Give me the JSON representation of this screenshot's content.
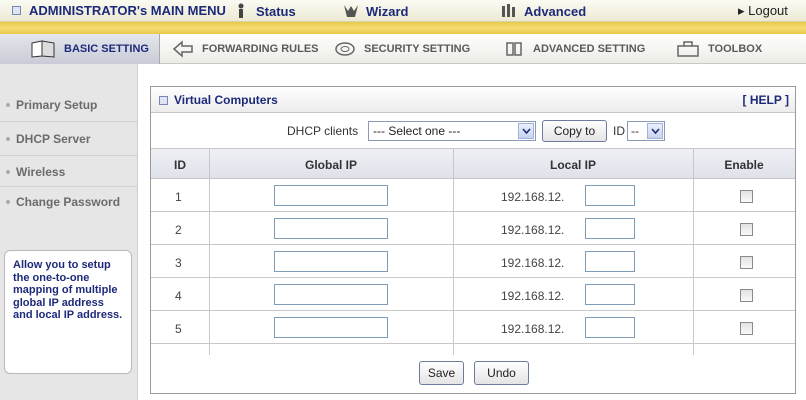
{
  "topbar": {
    "admin_menu": "ADMINISTRATOR's MAIN MENU",
    "status": "Status",
    "wizard": "Wizard",
    "advanced": "Advanced",
    "logout": "▸ Logout"
  },
  "tabs": {
    "basic": "BASIC SETTING",
    "forwarding": "FORWARDING RULES",
    "security": "SECURITY SETTING",
    "advanced": "ADVANCED SETTING",
    "toolbox": "TOOLBOX"
  },
  "sidebar": {
    "items": [
      "Primary Setup",
      "DHCP Server",
      "Wireless",
      "Change Password"
    ],
    "help_text": "Allow you to setup the one-to-one mapping of multiple global IP address and local IP address."
  },
  "panel": {
    "title": "Virtual Computers",
    "help": "[ HELP ]",
    "dhcp_label": "DHCP clients",
    "dhcp_select": "--- Select one ---",
    "copy_button": "Copy to",
    "id_label": "ID",
    "id_select": "--",
    "columns": [
      "ID",
      "Global IP",
      "Local IP",
      "Enable"
    ],
    "rows": [
      {
        "id": "1",
        "local_prefix": "192.168.12."
      },
      {
        "id": "2",
        "local_prefix": "192.168.12."
      },
      {
        "id": "3",
        "local_prefix": "192.168.12."
      },
      {
        "id": "4",
        "local_prefix": "192.168.12."
      },
      {
        "id": "5",
        "local_prefix": "192.168.12."
      }
    ],
    "save": "Save",
    "undo": "Undo"
  },
  "colors": {
    "nav_text": "#1d2a7a",
    "gold_stripe": "#f0d35e",
    "sidebar_bg": "#e6e6e6"
  }
}
